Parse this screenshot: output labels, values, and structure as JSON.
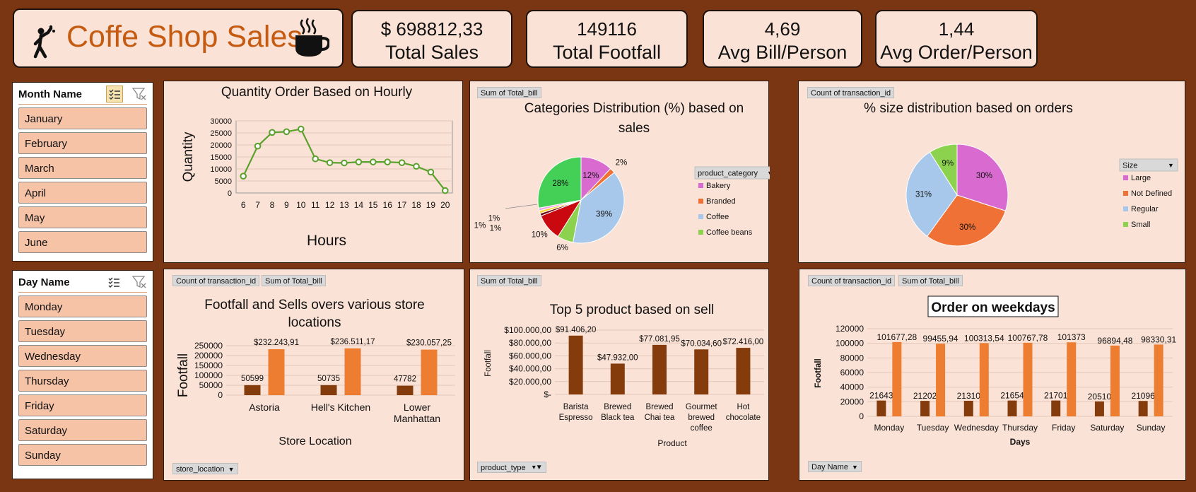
{
  "header": {
    "title": "Coffe Shop Sales"
  },
  "kpis": [
    {
      "value": "$ 698812,33",
      "label": "Total Sales"
    },
    {
      "value": "149116",
      "label": "Total Footfall"
    },
    {
      "value": "4,69",
      "label": "Avg Bill/Person"
    },
    {
      "value": "1,44",
      "label": "Avg Order/Person"
    }
  ],
  "month_slicer": {
    "title": "Month Name",
    "items": [
      "January",
      "February",
      "March",
      "April",
      "May",
      "June"
    ]
  },
  "day_slicer": {
    "title": "Day Name",
    "items": [
      "Monday",
      "Tuesday",
      "Wednesday",
      "Thursday",
      "Friday",
      "Saturday",
      "Sunday"
    ]
  },
  "pivot_buttons": {
    "cat_field": "Sum of Total_bill",
    "size_field": "Count of transaction_id",
    "store_field1": "Count of transaction_id",
    "store_field2": "Sum of Total_bill",
    "store_axis": "store_location",
    "prod_field": "Sum of Total_bill",
    "prod_axis": "product_type",
    "week_field1": "Count of transaction_id",
    "week_field2": "Sum of Total_bill",
    "week_axis": "Day Name"
  },
  "chart_data": [
    {
      "id": "hourly",
      "type": "line",
      "title": "Quantity Order Based on Hourly",
      "xlabel": "Hours",
      "ylabel": "Quantity",
      "x": [
        "6",
        "7",
        "8",
        "9",
        "10",
        "11",
        "12",
        "13",
        "14",
        "15",
        "16",
        "17",
        "18",
        "19",
        "20"
      ],
      "values": [
        7000,
        19500,
        25200,
        25500,
        26600,
        14200,
        12600,
        12500,
        12900,
        12900,
        12900,
        12600,
        11100,
        8700,
        1000
      ],
      "ylim": [
        0,
        30000
      ],
      "yticks": [
        "0",
        "5000",
        "10000",
        "15000",
        "20000",
        "25000",
        "30000"
      ],
      "color": "#5aa02c"
    },
    {
      "id": "categories",
      "type": "pie",
      "title": "Categories Distribution (%) based on sales",
      "legend_title": "product_category",
      "legend_items": [
        "Bakery",
        "Branded",
        "Coffee",
        "Coffee beans"
      ],
      "slices": [
        {
          "label": "12%",
          "value": 12,
          "color": "#d96bd0"
        },
        {
          "label": "2%",
          "value": 2,
          "color": "#ef7136"
        },
        {
          "label": "39%",
          "value": 39,
          "color": "#a7c8ea"
        },
        {
          "label": "6%",
          "value": 6,
          "color": "#8dd24f"
        },
        {
          "label": "10%",
          "value": 10,
          "color": "#c9090f"
        },
        {
          "label": "1%",
          "value": 1,
          "color": "#6b0a16"
        },
        {
          "label": "1%",
          "value": 1,
          "color": "#ffd32a"
        },
        {
          "label": "1%",
          "value": 1,
          "color": "#f2a7e9"
        },
        {
          "label": "28%",
          "value": 28,
          "color": "#44cf56"
        }
      ],
      "legend_colors": [
        "#d96bd0",
        "#ef7136",
        "#a7c8ea",
        "#8dd24f"
      ]
    },
    {
      "id": "size",
      "type": "pie",
      "title": "% size distribution based on orders",
      "legend_title": "Size",
      "legend_items": [
        "Large",
        "Not Defined",
        "Regular",
        "Small"
      ],
      "slices": [
        {
          "label": "30%",
          "value": 30,
          "color": "#d96bd0"
        },
        {
          "label": "30%",
          "value": 30,
          "color": "#ef7136"
        },
        {
          "label": "31%",
          "value": 31,
          "color": "#a7c8ea"
        },
        {
          "label": "9%",
          "value": 9,
          "color": "#8dd24f"
        }
      ],
      "legend_colors": [
        "#d96bd0",
        "#ef7136",
        "#a7c8ea",
        "#8dd24f"
      ]
    },
    {
      "id": "store",
      "type": "bar",
      "title": "Footfall and Sells  overs various store locations",
      "xlabel": "Store Location",
      "ylabel": "Footfall",
      "categories": [
        "Astoria",
        "Hell's Kitchen",
        "Lower Manhattan"
      ],
      "series": [
        {
          "values": [
            50599,
            50735,
            47782
          ],
          "labels": [
            "50599",
            "50735",
            "47782"
          ],
          "color": "#843c0c"
        },
        {
          "values": [
            232243.91,
            236511.17,
            230057.25
          ],
          "labels": [
            "$232.243,91",
            "$236.511,17",
            "$230.057,25"
          ],
          "color": "#ed7d31"
        }
      ],
      "ylim": [
        0,
        250000
      ],
      "yticks": [
        "0",
        "50000",
        "100000",
        "150000",
        "200000",
        "250000"
      ]
    },
    {
      "id": "product",
      "type": "bar",
      "title": "Top 5 product based on sell",
      "xlabel": "Product",
      "ylabel": "Footfall",
      "categories": [
        "Barista Espresso",
        "Brewed Black tea",
        "Brewed Chai tea",
        "Gourmet brewed coffee",
        "Hot chocolate"
      ],
      "series": [
        {
          "values": [
            91406.2,
            47932.0,
            77081.95,
            70034.6,
            72416.0
          ],
          "labels": [
            "$91.406,20",
            "$47.932,00",
            "$77.081,95",
            "$70.034,60",
            "$72.416,00"
          ],
          "color": "#843c0c"
        }
      ],
      "ylim": [
        0,
        100000
      ],
      "yticks": [
        "$-",
        "$20.000,00",
        "$40.000,00",
        "$60.000,00",
        "$80.000,00",
        "$100.000,00"
      ]
    },
    {
      "id": "weekday",
      "type": "bar",
      "title": "Order on weekdays",
      "xlabel": "Days",
      "ylabel": "Footfall",
      "categories": [
        "Monday",
        "Tuesday",
        "Wednesday",
        "Thursday",
        "Friday",
        "Saturday",
        "Sunday"
      ],
      "series": [
        {
          "values": [
            21643,
            21202,
            21310,
            21654,
            21701,
            20510,
            21096
          ],
          "labels": [
            "21643",
            "21202",
            "21310",
            "21654",
            "21701",
            "20510",
            "21096"
          ],
          "color": "#843c0c"
        },
        {
          "values": [
            101677.28,
            99455.94,
            100313.54,
            100767.78,
            101373,
            96894.48,
            98330.31
          ],
          "labels": [
            "101677,28",
            "99455,94",
            "100313,54",
            "100767,78",
            "101373",
            "96894,48",
            "98330,31"
          ],
          "color": "#ed7d31"
        }
      ],
      "ylim": [
        0,
        120000
      ],
      "yticks": [
        "0",
        "20000",
        "40000",
        "60000",
        "80000",
        "100000",
        "120000"
      ]
    }
  ]
}
